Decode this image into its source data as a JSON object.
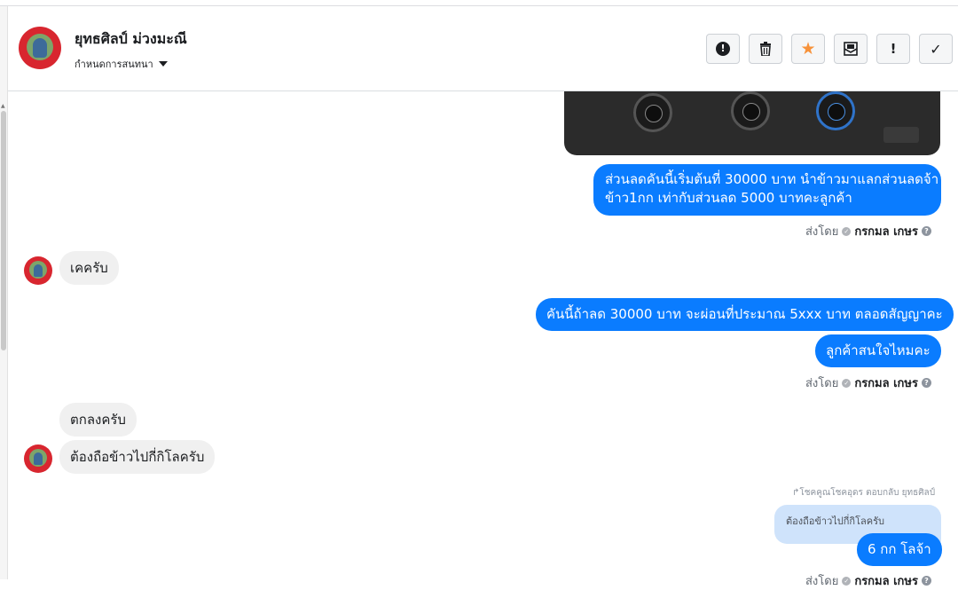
{
  "header": {
    "contact_name": "ยุทธศิลป์ ม่วงมะณี",
    "conversation_settings": "กำหนดการสนทนา",
    "actions": [
      {
        "icon": "exclamation-circle-icon",
        "glyph": "❗"
      },
      {
        "icon": "trash-icon",
        "glyph": "🗑"
      },
      {
        "icon": "star-icon",
        "glyph": "★"
      },
      {
        "icon": "mark-unread-icon",
        "glyph": "✉"
      },
      {
        "icon": "follow-up-icon",
        "glyph": "!"
      },
      {
        "icon": "done-check-icon",
        "glyph": "✓"
      }
    ]
  },
  "messages": {
    "out1": "ส่วนลดคันนี้เริ่มต้นที่ 30000 บาท นำข้าวมาแลกส่วนลดจ้า",
    "out1b": "ข้าว1กก เท่ากับส่วนลด 5000 บาทคะลูกค้า",
    "in1": "เคครับ",
    "out2": "คันนี้ถ้าลด 30000 บาท จะผ่อนที่ประมาณ 5xxx บาท ตลอดสัญญาคะ",
    "out3": "ลูกค้าสนใจไหมคะ",
    "in2": "ตกลงครับ",
    "in3": "ต้องถือข้าวไปกี่กิโลครับ",
    "reply_note": "โชคคูณโชคอุดร ตอบกลับ ยุทธศิลป์",
    "quoted": "ต้องถือข้าวไปกี่กิโลครับ",
    "out4": "6 กก โลจ้า"
  },
  "sent_by": {
    "label": "ส่งโดย",
    "name": "กรกมล เกษร"
  },
  "colors": {
    "outgoing": "#0a7cff",
    "incoming": "#f0f0f0",
    "star": "#f7923a"
  }
}
